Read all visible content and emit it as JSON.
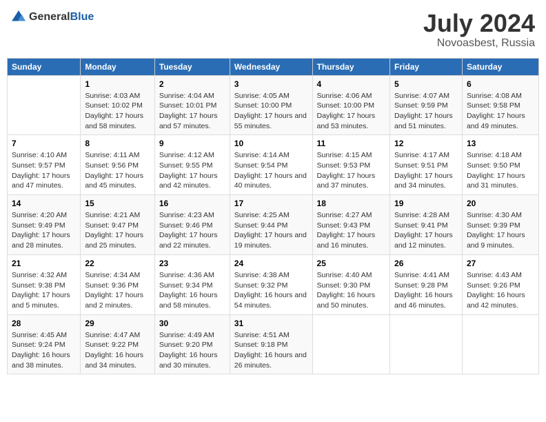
{
  "header": {
    "logo_general": "General",
    "logo_blue": "Blue",
    "month_year": "July 2024",
    "location": "Novoasbest, Russia"
  },
  "days_of_week": [
    "Sunday",
    "Monday",
    "Tuesday",
    "Wednesday",
    "Thursday",
    "Friday",
    "Saturday"
  ],
  "weeks": [
    [
      {
        "day": "",
        "sunrise": "",
        "sunset": "",
        "daylight": ""
      },
      {
        "day": "1",
        "sunrise": "Sunrise: 4:03 AM",
        "sunset": "Sunset: 10:02 PM",
        "daylight": "Daylight: 17 hours and 58 minutes."
      },
      {
        "day": "2",
        "sunrise": "Sunrise: 4:04 AM",
        "sunset": "Sunset: 10:01 PM",
        "daylight": "Daylight: 17 hours and 57 minutes."
      },
      {
        "day": "3",
        "sunrise": "Sunrise: 4:05 AM",
        "sunset": "Sunset: 10:00 PM",
        "daylight": "Daylight: 17 hours and 55 minutes."
      },
      {
        "day": "4",
        "sunrise": "Sunrise: 4:06 AM",
        "sunset": "Sunset: 10:00 PM",
        "daylight": "Daylight: 17 hours and 53 minutes."
      },
      {
        "day": "5",
        "sunrise": "Sunrise: 4:07 AM",
        "sunset": "Sunset: 9:59 PM",
        "daylight": "Daylight: 17 hours and 51 minutes."
      },
      {
        "day": "6",
        "sunrise": "Sunrise: 4:08 AM",
        "sunset": "Sunset: 9:58 PM",
        "daylight": "Daylight: 17 hours and 49 minutes."
      }
    ],
    [
      {
        "day": "7",
        "sunrise": "Sunrise: 4:10 AM",
        "sunset": "Sunset: 9:57 PM",
        "daylight": "Daylight: 17 hours and 47 minutes."
      },
      {
        "day": "8",
        "sunrise": "Sunrise: 4:11 AM",
        "sunset": "Sunset: 9:56 PM",
        "daylight": "Daylight: 17 hours and 45 minutes."
      },
      {
        "day": "9",
        "sunrise": "Sunrise: 4:12 AM",
        "sunset": "Sunset: 9:55 PM",
        "daylight": "Daylight: 17 hours and 42 minutes."
      },
      {
        "day": "10",
        "sunrise": "Sunrise: 4:14 AM",
        "sunset": "Sunset: 9:54 PM",
        "daylight": "Daylight: 17 hours and 40 minutes."
      },
      {
        "day": "11",
        "sunrise": "Sunrise: 4:15 AM",
        "sunset": "Sunset: 9:53 PM",
        "daylight": "Daylight: 17 hours and 37 minutes."
      },
      {
        "day": "12",
        "sunrise": "Sunrise: 4:17 AM",
        "sunset": "Sunset: 9:51 PM",
        "daylight": "Daylight: 17 hours and 34 minutes."
      },
      {
        "day": "13",
        "sunrise": "Sunrise: 4:18 AM",
        "sunset": "Sunset: 9:50 PM",
        "daylight": "Daylight: 17 hours and 31 minutes."
      }
    ],
    [
      {
        "day": "14",
        "sunrise": "Sunrise: 4:20 AM",
        "sunset": "Sunset: 9:49 PM",
        "daylight": "Daylight: 17 hours and 28 minutes."
      },
      {
        "day": "15",
        "sunrise": "Sunrise: 4:21 AM",
        "sunset": "Sunset: 9:47 PM",
        "daylight": "Daylight: 17 hours and 25 minutes."
      },
      {
        "day": "16",
        "sunrise": "Sunrise: 4:23 AM",
        "sunset": "Sunset: 9:46 PM",
        "daylight": "Daylight: 17 hours and 22 minutes."
      },
      {
        "day": "17",
        "sunrise": "Sunrise: 4:25 AM",
        "sunset": "Sunset: 9:44 PM",
        "daylight": "Daylight: 17 hours and 19 minutes."
      },
      {
        "day": "18",
        "sunrise": "Sunrise: 4:27 AM",
        "sunset": "Sunset: 9:43 PM",
        "daylight": "Daylight: 17 hours and 16 minutes."
      },
      {
        "day": "19",
        "sunrise": "Sunrise: 4:28 AM",
        "sunset": "Sunset: 9:41 PM",
        "daylight": "Daylight: 17 hours and 12 minutes."
      },
      {
        "day": "20",
        "sunrise": "Sunrise: 4:30 AM",
        "sunset": "Sunset: 9:39 PM",
        "daylight": "Daylight: 17 hours and 9 minutes."
      }
    ],
    [
      {
        "day": "21",
        "sunrise": "Sunrise: 4:32 AM",
        "sunset": "Sunset: 9:38 PM",
        "daylight": "Daylight: 17 hours and 5 minutes."
      },
      {
        "day": "22",
        "sunrise": "Sunrise: 4:34 AM",
        "sunset": "Sunset: 9:36 PM",
        "daylight": "Daylight: 17 hours and 2 minutes."
      },
      {
        "day": "23",
        "sunrise": "Sunrise: 4:36 AM",
        "sunset": "Sunset: 9:34 PM",
        "daylight": "Daylight: 16 hours and 58 minutes."
      },
      {
        "day": "24",
        "sunrise": "Sunrise: 4:38 AM",
        "sunset": "Sunset: 9:32 PM",
        "daylight": "Daylight: 16 hours and 54 minutes."
      },
      {
        "day": "25",
        "sunrise": "Sunrise: 4:40 AM",
        "sunset": "Sunset: 9:30 PM",
        "daylight": "Daylight: 16 hours and 50 minutes."
      },
      {
        "day": "26",
        "sunrise": "Sunrise: 4:41 AM",
        "sunset": "Sunset: 9:28 PM",
        "daylight": "Daylight: 16 hours and 46 minutes."
      },
      {
        "day": "27",
        "sunrise": "Sunrise: 4:43 AM",
        "sunset": "Sunset: 9:26 PM",
        "daylight": "Daylight: 16 hours and 42 minutes."
      }
    ],
    [
      {
        "day": "28",
        "sunrise": "Sunrise: 4:45 AM",
        "sunset": "Sunset: 9:24 PM",
        "daylight": "Daylight: 16 hours and 38 minutes."
      },
      {
        "day": "29",
        "sunrise": "Sunrise: 4:47 AM",
        "sunset": "Sunset: 9:22 PM",
        "daylight": "Daylight: 16 hours and 34 minutes."
      },
      {
        "day": "30",
        "sunrise": "Sunrise: 4:49 AM",
        "sunset": "Sunset: 9:20 PM",
        "daylight": "Daylight: 16 hours and 30 minutes."
      },
      {
        "day": "31",
        "sunrise": "Sunrise: 4:51 AM",
        "sunset": "Sunset: 9:18 PM",
        "daylight": "Daylight: 16 hours and 26 minutes."
      },
      {
        "day": "",
        "sunrise": "",
        "sunset": "",
        "daylight": ""
      },
      {
        "day": "",
        "sunrise": "",
        "sunset": "",
        "daylight": ""
      },
      {
        "day": "",
        "sunrise": "",
        "sunset": "",
        "daylight": ""
      }
    ]
  ]
}
